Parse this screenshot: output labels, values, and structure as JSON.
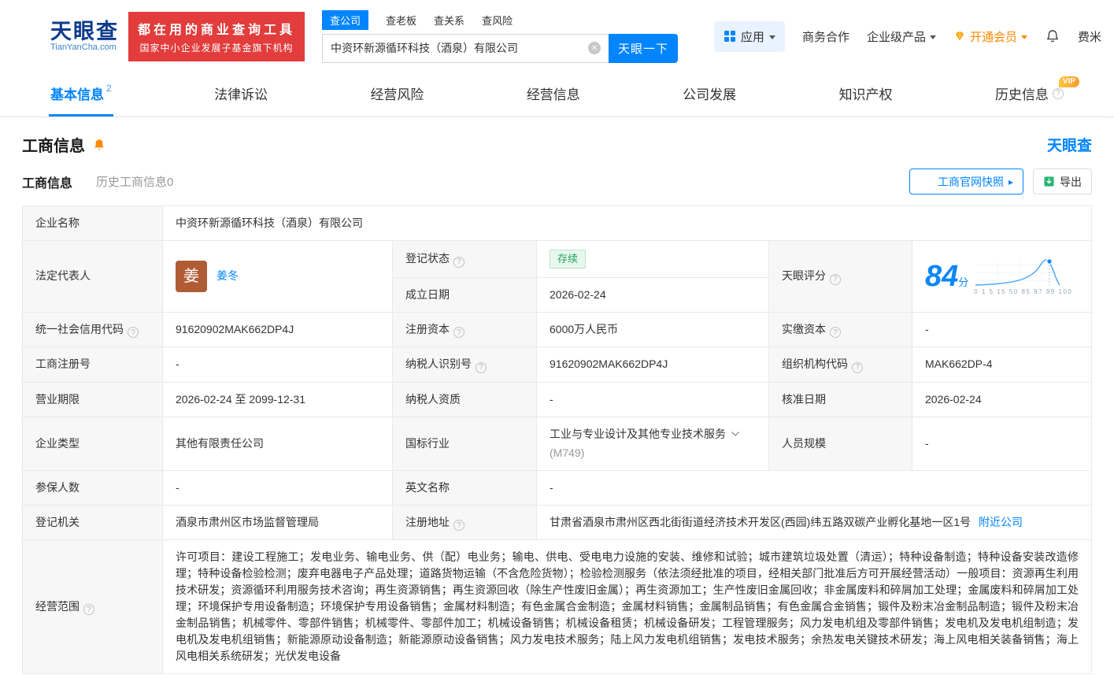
{
  "colors": {
    "accent_blue": "#0084ff",
    "banner_red": "#e23c3c",
    "vip_orange": "#ff8a00",
    "status_green": "#20a860"
  },
  "brand": {
    "name": "天眼查",
    "domain": "TianYanCha.com",
    "banner_line1": "都在用的商业查询工具",
    "banner_line2": "国家中小企业发展子基金旗下机构"
  },
  "search": {
    "tabs": [
      {
        "label": "查公司"
      },
      {
        "label": "查老板"
      },
      {
        "label": "查关系"
      },
      {
        "label": "查风险"
      }
    ],
    "value": "中资环新源循环科技（酒泉）有限公司",
    "button": "天眼一下"
  },
  "topnav": {
    "apps": "应用",
    "cooperation": "商务合作",
    "enterprise": "企业级产品",
    "vip": "开通会员",
    "username": "费米"
  },
  "tabs": {
    "basic": "基本信息",
    "basic_badge": "2",
    "legal": "法律诉讼",
    "risk": "经营风险",
    "operation": "经营信息",
    "development": "公司发展",
    "ip": "知识产权",
    "history": "历史信息",
    "history_vip": "VIP"
  },
  "section": {
    "title": "工商信息",
    "brand": "天眼查",
    "subtab_active": "工商信息",
    "subtab_history": "历史工商信息0",
    "snapshot_button": "工商官网快照",
    "export_button": "导出"
  },
  "info": {
    "company_name_label": "企业名称",
    "company_name": "中资环新源循环科技（酒泉）有限公司",
    "legal_rep_label": "法定代表人",
    "legal_rep_avatar": "姜",
    "legal_rep_name": "姜冬",
    "reg_status_label": "登记状态",
    "reg_status": "存续",
    "score_label": "天眼评分",
    "score": "84",
    "score_unit": "分",
    "score_axis": "0 1 5 15 50 85 97 99 100",
    "establish_label": "成立日期",
    "establish_date": "2026-02-24",
    "credit_code_label": "统一社会信用代码",
    "credit_code": "91620902MAK662DP4J",
    "reg_capital_label": "注册资本",
    "reg_capital": "6000万人民币",
    "paid_capital_label": "实缴资本",
    "paid_capital": "-",
    "reg_number_label": "工商注册号",
    "reg_number": "-",
    "taxpayer_id_label": "纳税人识别号",
    "taxpayer_id": "91620902MAK662DP4J",
    "org_code_label": "组织机构代码",
    "org_code": "MAK662DP-4",
    "business_term_label": "营业期限",
    "business_term": "2026-02-24 至 2099-12-31",
    "taxpayer_quality_label": "纳税人资质",
    "taxpayer_quality": "-",
    "approval_date_label": "核准日期",
    "approval_date": "2026-02-24",
    "company_type_label": "企业类型",
    "company_type": "其他有限责任公司",
    "industry_label": "国标行业",
    "industry": "工业与专业设计及其他专业技术服务",
    "industry_code": "(M749)",
    "staff_size_label": "人员规模",
    "staff_size": "-",
    "insured_label": "参保人数",
    "insured": "-",
    "english_name_label": "英文名称",
    "english_name": "-",
    "reg_authority_label": "登记机关",
    "reg_authority": "酒泉市肃州区市场监督管理局",
    "address_label": "注册地址",
    "address": "甘肃省酒泉市肃州区西北街街道经济技术开发区(西园)纬五路双碳产业孵化基地一区1号",
    "nearby_link": "附近公司",
    "scope_label": "经营范围",
    "scope": "许可项目：建设工程施工；发电业务、输电业务、供（配）电业务；输电、供电、受电电力设施的安装、维修和试验；城市建筑垃圾处置（清运）；特种设备制造；特种设备安装改造修理；特种设备检验检测；废弃电器电子产品处理；道路货物运输（不含危险货物）；检验检测服务（依法须经批准的项目，经相关部门批准后方可开展经营活动）一般项目：资源再生利用技术研发；资源循环利用服务技术咨询；再生资源销售；再生资源回收（除生产性废旧金属）；再生资源加工；生产性废旧金属回收；非金属废料和碎屑加工处理；金属废料和碎屑加工处理；环境保护专用设备制造；环境保护专用设备销售；金属材料制造；有色金属合金制造；金属材料销售；金属制品销售；有色金属合金销售；锻件及粉末冶金制品制造；锻件及粉末冶金制品销售；机械零件、零部件销售；机械零件、零部件加工；机械设备销售；机械设备租赁；机械设备研发；工程管理服务；风力发电机组及零部件销售；发电机及发电机组制造；发电机及发电机组销售；新能源原动设备制造；新能源原动设备销售；风力发电技术服务；陆上风力发电机组销售；发电技术服务；余热发电关键技术研发；海上风电相关装备销售；海上风电相关系统研发；光伏发电设备"
  }
}
